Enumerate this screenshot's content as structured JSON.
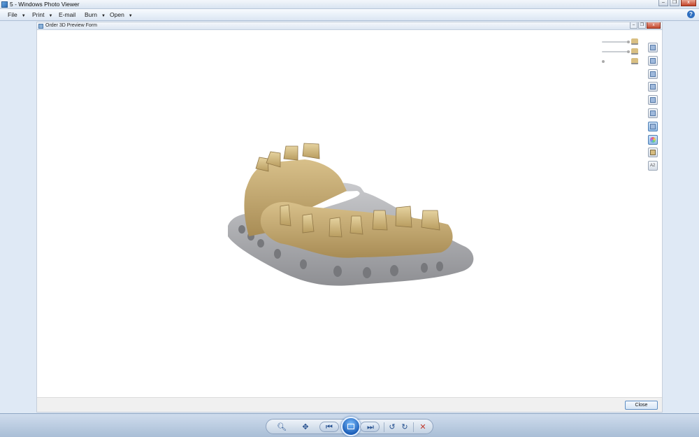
{
  "window": {
    "title": "5 - Windows Photo Viewer"
  },
  "menu": [
    {
      "label": "File",
      "has_dropdown": true
    },
    {
      "label": "Print",
      "has_dropdown": true
    },
    {
      "label": "E-mail",
      "has_dropdown": false
    },
    {
      "label": "Burn",
      "has_dropdown": true
    },
    {
      "label": "Open",
      "has_dropdown": true
    }
  ],
  "form": {
    "title": "Order 3D Preview Form",
    "close_label": "Close",
    "window_buttons": {
      "minimize": "–",
      "restore": "❐",
      "close": "x"
    }
  },
  "outer_window_buttons": {
    "minimize": "–",
    "restore": "❐",
    "close": "x"
  },
  "help": {
    "icon": "?"
  },
  "toolbar": {
    "tools": [
      {
        "name": "view-front-icon",
        "active": false
      },
      {
        "name": "view-back-icon",
        "active": false
      },
      {
        "name": "view-left-icon",
        "active": false
      },
      {
        "name": "view-right-icon",
        "active": false
      },
      {
        "name": "view-top-icon",
        "active": false
      },
      {
        "name": "view-bottom-icon",
        "active": false
      },
      {
        "name": "render-mode-icon",
        "active": true
      },
      {
        "name": "color-mode-icon",
        "active": true
      },
      {
        "name": "tooth-model-icon",
        "active": false
      },
      {
        "name": "text-label-icon",
        "active": false,
        "text": "A2"
      }
    ]
  },
  "sliders": [
    {
      "name": "upper-jaw-opacity-slider",
      "level": 0.9
    },
    {
      "name": "lower-jaw-opacity-slider",
      "level": 0.9
    },
    {
      "name": "model-opacity-slider",
      "level": 0.0
    }
  ],
  "colors": {
    "tooth": "#d6bc80",
    "base": "#a9aaad",
    "accent": "#2f6fc0"
  }
}
